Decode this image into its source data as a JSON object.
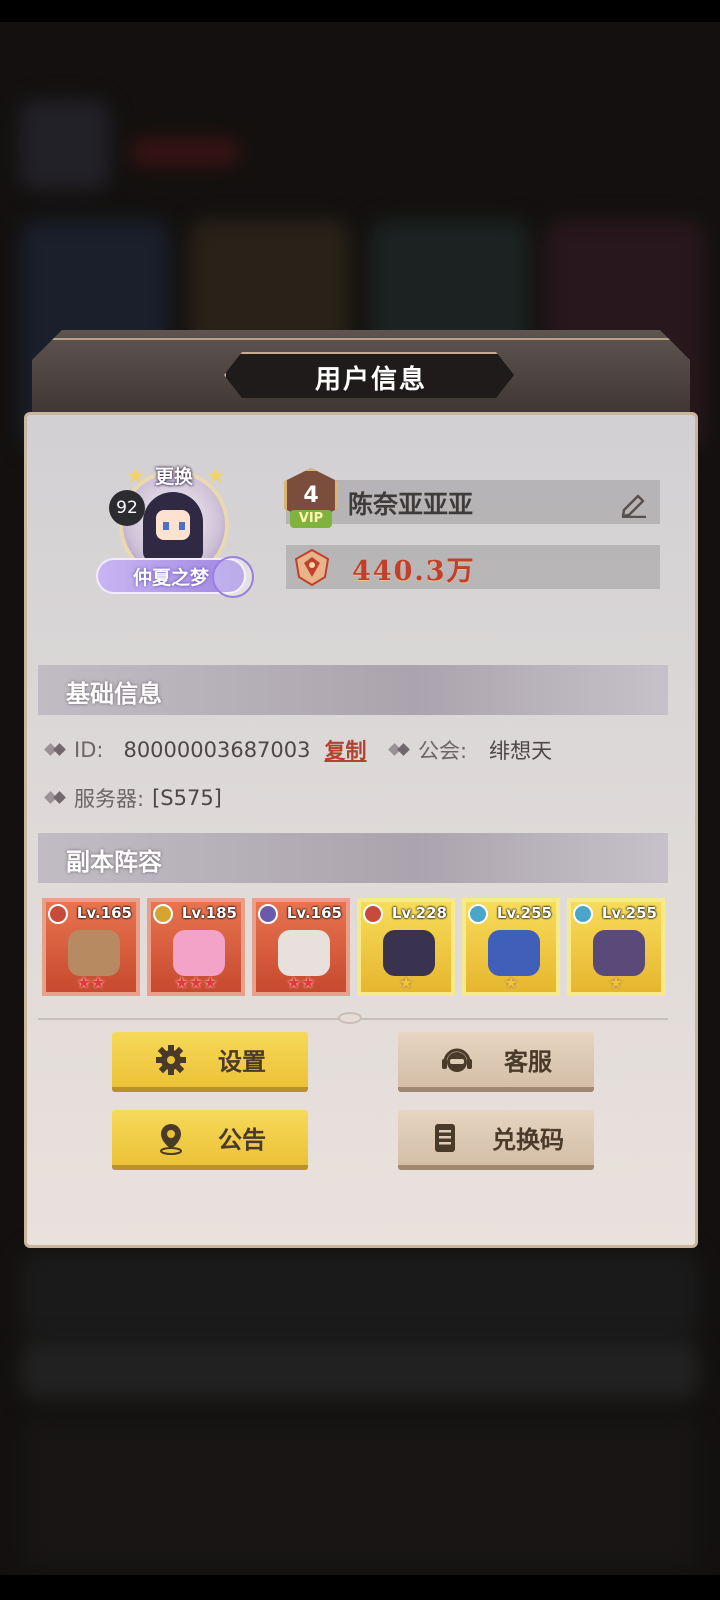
{
  "dialog": {
    "title": "用户信息"
  },
  "profile": {
    "change_label": "更换",
    "level": "92",
    "title_badge": "仲夏之梦",
    "vip_level": "4",
    "vip_tag": "VIP",
    "name": "陈奈亚亚亚",
    "power": "440.3万"
  },
  "basic_info": {
    "header": "基础信息",
    "id_label": "ID:",
    "id_value": "80000003687003",
    "copy_label": "复制",
    "guild_label": "公会:",
    "guild_value": "绯想天",
    "server_label": "服务器:",
    "server_value": "[S575]"
  },
  "lineup": {
    "header": "副本阵容",
    "heroes": [
      {
        "level": "Lv.165",
        "frame": "red",
        "stars": 2,
        "element_color": "#c84a3a"
      },
      {
        "level": "Lv.185",
        "frame": "red",
        "stars": 3,
        "element_color": "#d4a531"
      },
      {
        "level": "Lv.165",
        "frame": "red",
        "stars": 2,
        "element_color": "#6a5aa8"
      },
      {
        "level": "Lv.228",
        "frame": "gold",
        "stars": 1,
        "element_color": "#c84a3a"
      },
      {
        "level": "Lv.255",
        "frame": "gold",
        "stars": 1,
        "element_color": "#4aa6c9"
      },
      {
        "level": "Lv.255",
        "frame": "gold",
        "stars": 1,
        "element_color": "#4aa6c9"
      }
    ]
  },
  "buttons": {
    "settings": "设置",
    "customer_service": "客服",
    "announcement": "公告",
    "redeem_code": "兑换码"
  },
  "icons": {
    "settings": "gear-icon",
    "customer_service": "headset-icon",
    "announcement": "location-pin-icon",
    "redeem_code": "ticket-icon",
    "edit": "edit-pencil-icon",
    "power": "power-crest-icon"
  },
  "colors": {
    "power_text": "#c1402d",
    "copy_link": "#b2432e",
    "yellow_button": "#ebc236",
    "beige_button": "#d4bea7"
  }
}
